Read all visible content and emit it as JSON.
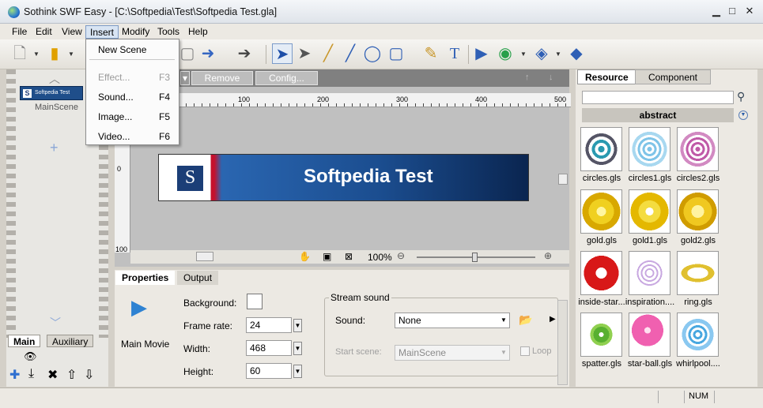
{
  "window": {
    "title": "Sothink SWF Easy - [C:\\Softpedia\\Test\\Softpedia Test.gla]"
  },
  "menubar": {
    "items": [
      "File",
      "Edit",
      "View",
      "Insert",
      "Modify",
      "Tools",
      "Help"
    ]
  },
  "insert_menu": {
    "items": [
      {
        "label": "New Scene",
        "shortcut": "",
        "enabled": true
      },
      {
        "label": "Effect...",
        "shortcut": "F3",
        "enabled": false
      },
      {
        "label": "Sound...",
        "shortcut": "F4",
        "enabled": true
      },
      {
        "label": "Image...",
        "shortcut": "F5",
        "enabled": true
      },
      {
        "label": "Video...",
        "shortcut": "F6",
        "enabled": true
      }
    ]
  },
  "scenes": {
    "thumb_caption": "Softpedia Test",
    "name": "MainScene",
    "tabs": [
      "Main",
      "Auxiliary"
    ]
  },
  "stage": {
    "buttons": [
      "Remove",
      "Config..."
    ],
    "ruler": [
      "100",
      "200",
      "300",
      "400",
      "500"
    ],
    "vruler": [
      "0",
      "100"
    ],
    "banner_text": "Softpedia Test",
    "banner_logo": "S",
    "zoom": "100%"
  },
  "properties": {
    "tabs": [
      "Properties",
      "Output"
    ],
    "object": "Main Movie",
    "background_label": "Background:",
    "framerate_label": "Frame rate:",
    "framerate": "24",
    "width_label": "Width:",
    "width": "468",
    "height_label": "Height:",
    "height": "60",
    "stream_group": "Stream sound",
    "sound_label": "Sound:",
    "sound_value": "None",
    "start_label": "Start scene:",
    "start_value": "MainScene",
    "loop_label": "Loop"
  },
  "resource": {
    "tabs": [
      "Resource",
      "Component"
    ],
    "category": "abstract",
    "items": [
      "circles.gls",
      "circles1.gls",
      "circles2.gls",
      "gold.gls",
      "gold1.gls",
      "gold2.gls",
      "inside-star...",
      "inspiration....",
      "ring.gls",
      "spatter.gls",
      "star-ball.gls",
      "whirlpool...."
    ]
  },
  "statusbar": {
    "num": "NUM"
  }
}
